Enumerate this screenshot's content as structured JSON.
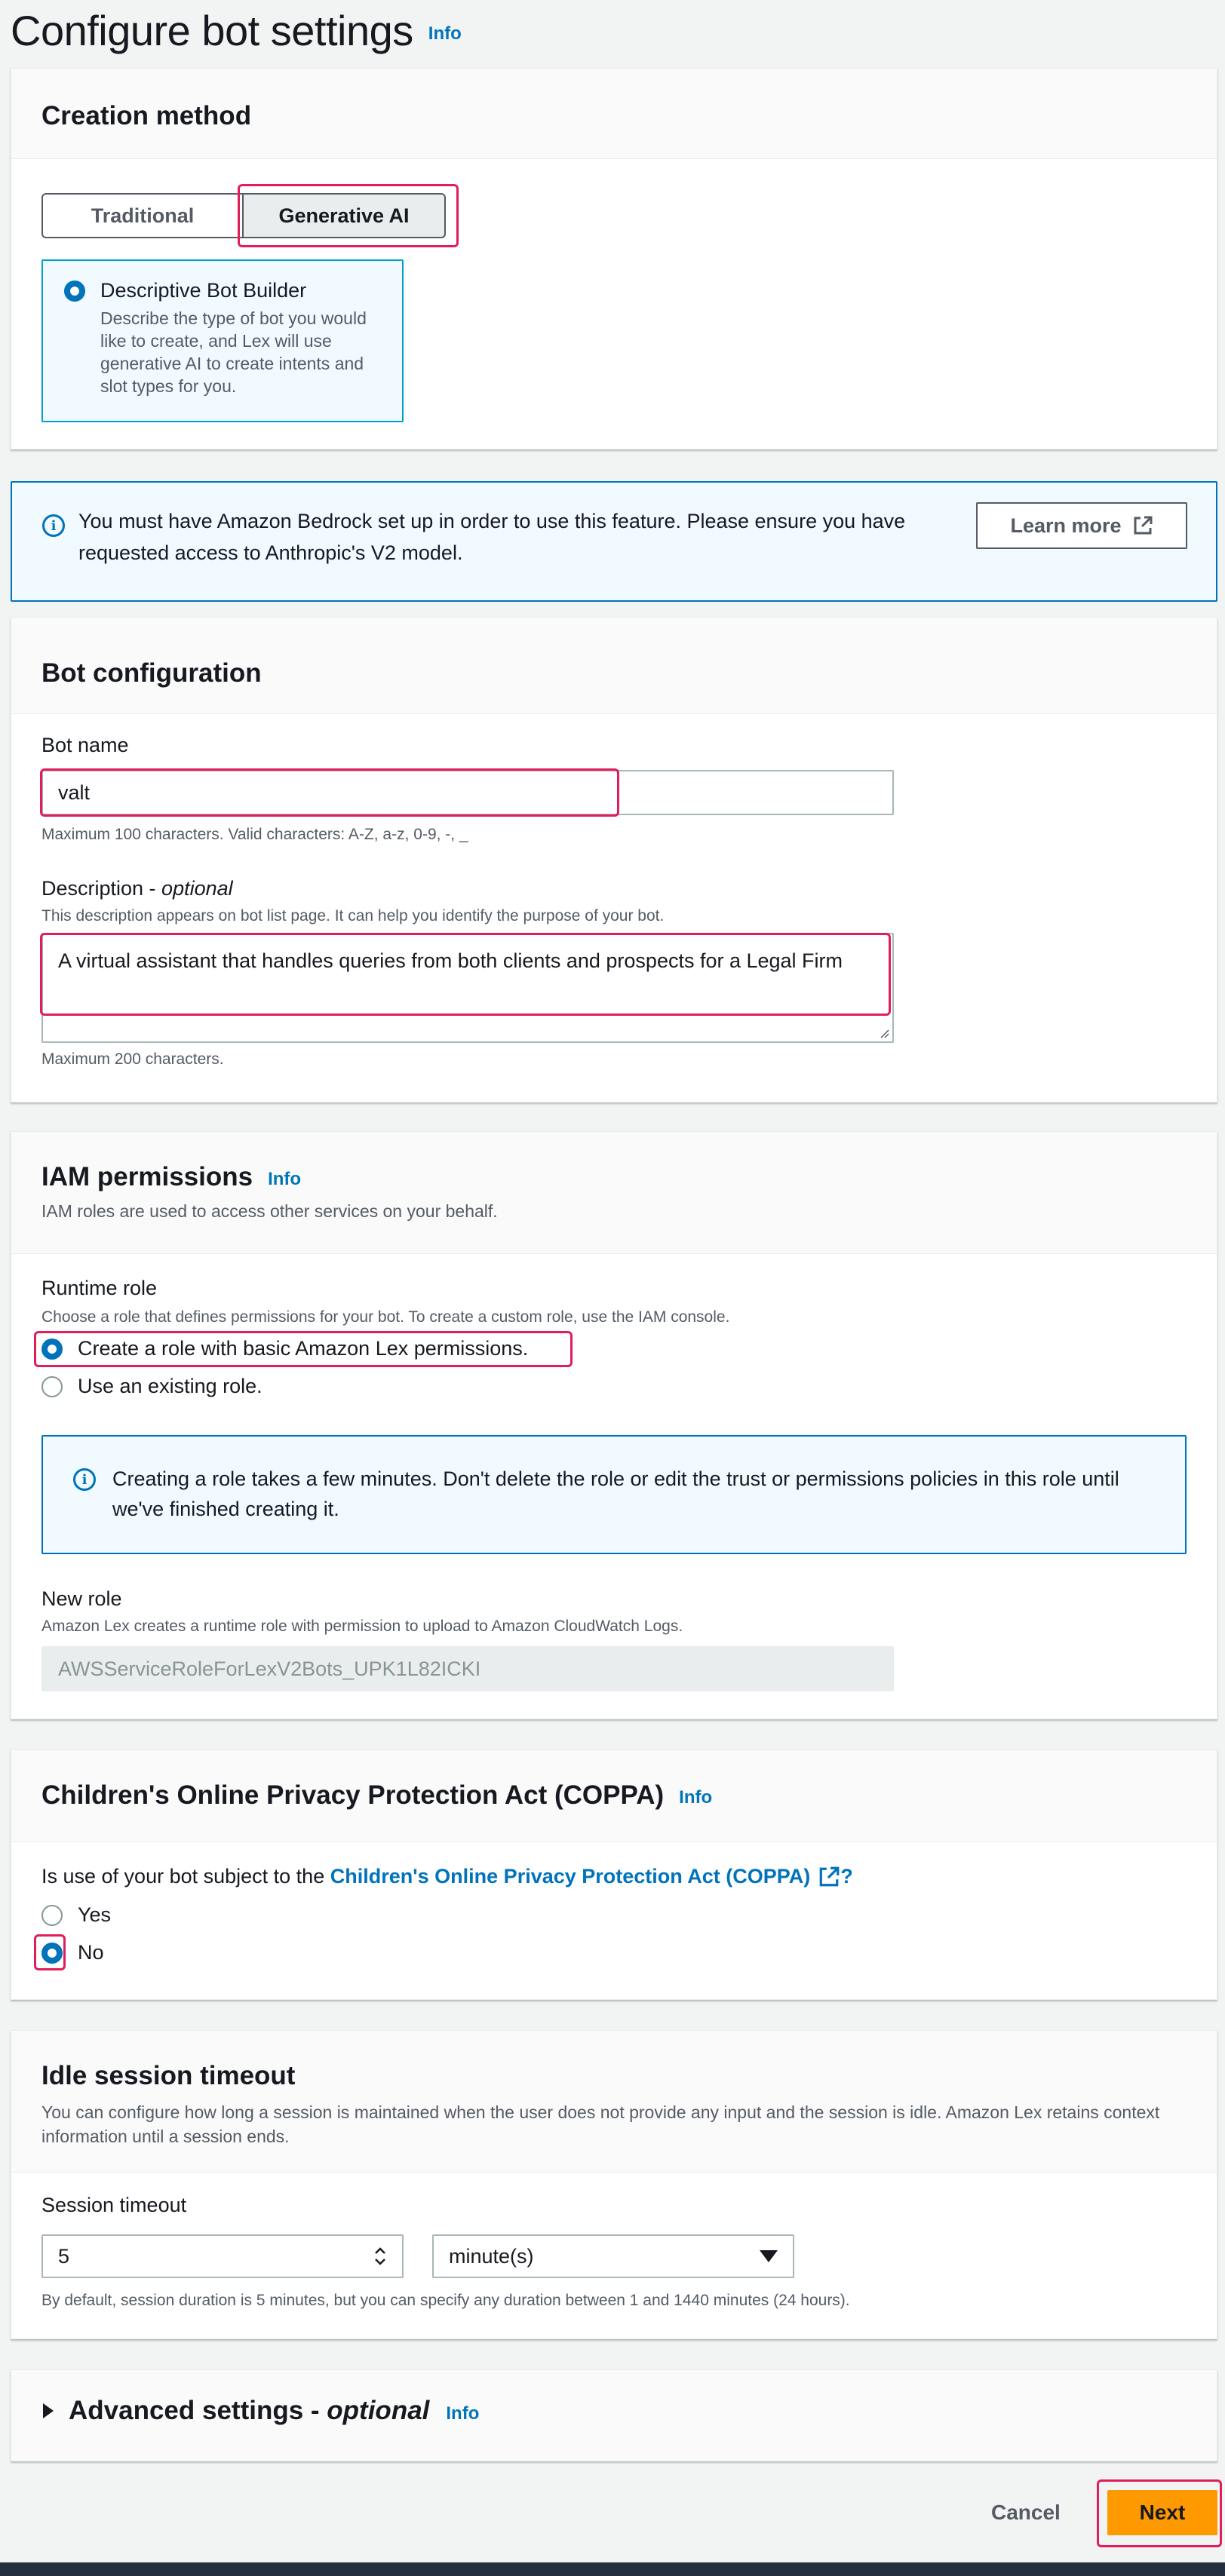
{
  "page": {
    "title": "Configure bot settings",
    "info": "Info"
  },
  "creation_method": {
    "title": "Creation method",
    "tabs": [
      "Traditional",
      "Generative AI"
    ],
    "selected_tab": "Generative AI",
    "tile": {
      "title": "Descriptive Bot Builder",
      "description": "Describe the type of bot you would like to create, and Lex will use generative AI to create intents and slot types for you."
    }
  },
  "bedrock_alert": {
    "text": "You must have Amazon Bedrock set up in order to use this feature. Please ensure you have requested access to Anthropic's V2 model.",
    "button": "Learn more"
  },
  "bot_configuration": {
    "title": "Bot configuration",
    "bot_name_label": "Bot name",
    "bot_name_value": "valt",
    "bot_name_hint": "Maximum 100 characters. Valid characters: A-Z, a-z, 0-9, -, _",
    "description_label": "Description - ",
    "description_optional": "optional",
    "description_hint_top": "This description appears on bot list page. It can help you identify the purpose of your bot.",
    "description_value": "A virtual assistant that handles queries from both clients and prospects  for a Legal Firm",
    "description_hint_bottom": "Maximum 200 characters."
  },
  "iam": {
    "title": "IAM permissions",
    "info": "Info",
    "description": "IAM roles are used to access other services on your behalf.",
    "runtime_role_label": "Runtime role",
    "runtime_role_hint": "Choose a role that defines permissions for your bot. To create a custom role, use the IAM console.",
    "options": [
      "Create a role with basic Amazon Lex permissions.",
      "Use an existing role."
    ],
    "selected_option": "Create a role with basic Amazon Lex permissions.",
    "alert_text": "Creating a role takes a few minutes. Don't delete the role or edit the trust or permissions policies in this role until we've finished creating it.",
    "new_role_label": "New role",
    "new_role_hint": "Amazon Lex creates a runtime role with permission to upload to Amazon CloudWatch Logs.",
    "new_role_value": "AWSServiceRoleForLexV2Bots_UPK1L82ICKI"
  },
  "coppa": {
    "title": "Children's Online Privacy Protection Act (COPPA)",
    "info": "Info",
    "question_prefix": "Is use of your bot subject to the ",
    "question_link": "Children's Online Privacy Protection Act (COPPA)",
    "question_suffix": "?",
    "options": [
      "Yes",
      "No"
    ],
    "selected_option": "No"
  },
  "idle_timeout": {
    "title": "Idle session timeout",
    "description": "You can configure how long a session is maintained when the user does not provide any input and the session is idle. Amazon Lex retains context information until a session ends.",
    "session_timeout_label": "Session timeout",
    "session_timeout_value": "5",
    "unit_value": "minute(s)",
    "hint": "By default, session duration is 5 minutes, but you can specify any duration between 1 and 1440 minutes (24 hours)."
  },
  "advanced": {
    "title": "Advanced settings - ",
    "optional": "optional",
    "info": "Info"
  },
  "footer": {
    "cancel": "Cancel",
    "next": "Next"
  },
  "colors": {
    "accent": "#0073bb",
    "primary_button": "#ff9900",
    "highlight": "#e01e5a",
    "tile_border": "#00a1c9"
  }
}
